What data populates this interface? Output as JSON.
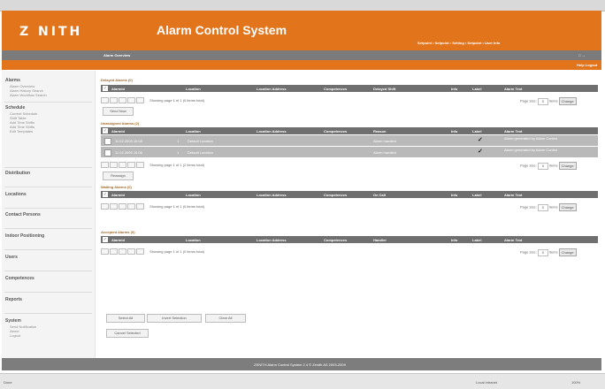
{
  "header": {
    "logo": "Z  NITH",
    "title": "Alarm Control System",
    "nav": "Setpoint • Setpoint • Setting • Setpoint • User Info",
    "page_title": "Alarm Overview",
    "window_icons": "□ →",
    "links": "Help   Logout"
  },
  "sidebar": {
    "sections": [
      {
        "label": "Alarms",
        "items": [
          "Alarm Overview",
          "Alarm History Search",
          "Alarm Workflow Search"
        ]
      },
      {
        "label": "Schedule",
        "items": [
          "Current Schedule",
          "Shift Table",
          "Add Time Shifts",
          "Add Time Shifts",
          "Edit Templates"
        ]
      },
      {
        "label": "Distribution",
        "items": []
      },
      {
        "label": "Locations",
        "items": []
      },
      {
        "label": "Contact Persons",
        "items": []
      },
      {
        "label": "Indoor Positioning",
        "items": []
      },
      {
        "label": "Users",
        "items": []
      },
      {
        "label": "Competences",
        "items": []
      },
      {
        "label": "Reports",
        "items": []
      },
      {
        "label": "System",
        "items": [
          "Send Notification",
          "About",
          "Logout"
        ]
      }
    ]
  },
  "tables": [
    {
      "title": "Delayed Alarms (0)",
      "columns": [
        "Alarmid",
        "",
        "Location",
        "Location Address",
        "Competences",
        "Delayed Shift",
        "Info",
        "Label",
        "Alarm Text"
      ],
      "rows": [],
      "pager": "Showing page 1 of 1 (0 items total)",
      "page_size_label": "Page size:",
      "page_size": "5",
      "items_label": "items",
      "change": "Change",
      "button": "Send Now"
    },
    {
      "title": "Unassigned Alarms (2)",
      "columns": [
        "Alarmid",
        "",
        "Location",
        "Location Address",
        "Competences",
        "Reason",
        "Info",
        "Label",
        "Alarm Text"
      ],
      "rows": [
        {
          "id": "11.02.2009 10:08",
          "flag": "1",
          "location": "Default Location",
          "address": "",
          "competences": "",
          "reason": "Alarm handled",
          "info": "✓",
          "label": "",
          "text": "Alarm generated by Alarm Control"
        },
        {
          "id": "11.02.2009 10:06",
          "flag": "1",
          "location": "Default Location",
          "address": "",
          "competences": "",
          "reason": "Alarm handled",
          "info": "✓",
          "label": "",
          "text": "Alarm generated by Alarm Control"
        }
      ],
      "pager": "Showing page 1 of 1 (2 items total)",
      "page_size_label": "Page size:",
      "page_size": "5",
      "items_label": "items",
      "change": "Change",
      "button": "Reassign"
    },
    {
      "title": "Waiting Alarms (0)",
      "columns": [
        "Alarmid",
        "",
        "Location",
        "Location Address",
        "Competences",
        "On Call",
        "Info",
        "Label",
        "Alarm Text"
      ],
      "rows": [],
      "pager": "Showing page 1 of 1 (0 items total)",
      "page_size_label": "Page size:",
      "page_size": "5",
      "items_label": "items",
      "change": "Change",
      "button": ""
    },
    {
      "title": "Accepted Alarms (0)",
      "columns": [
        "Alarmid",
        "",
        "Location",
        "Location Address",
        "Competences",
        "Handler",
        "Info",
        "Label",
        "Alarm Text"
      ],
      "rows": [],
      "pager": "Showing page 1 of 1 (0 items total)",
      "page_size_label": "Page size:",
      "page_size": "5",
      "items_label": "items",
      "change": "Change",
      "button": ""
    }
  ],
  "actions": {
    "select_all": "Select All",
    "invert_selection": "Invert Selection",
    "clear_all": "Clear All",
    "cancel_selected": "Cancel Selected"
  },
  "footer": {
    "text": "ZENITH Alarm Control System 2.4 © Zenith AS 2003-2009"
  },
  "statusbar": {
    "left": "Done",
    "zone": "Local intranet",
    "zoom": "100%"
  },
  "colors": {
    "accent": "#e2741c",
    "header_gray": "#6f6f6f",
    "row_gray": "#b9b9b9"
  }
}
